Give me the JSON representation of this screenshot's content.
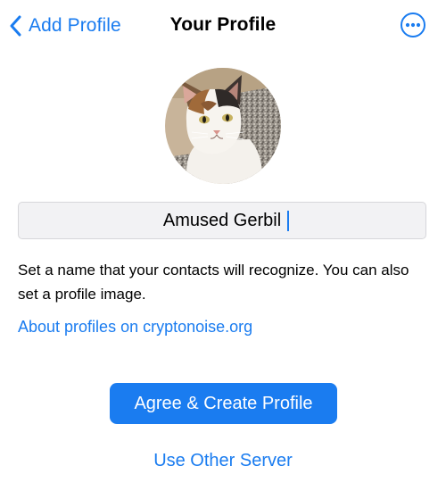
{
  "nav": {
    "back_label": "Add Profile",
    "title": "Your Profile",
    "more_icon": "ellipsis-circle-icon"
  },
  "profile": {
    "avatar_description": "profile photo",
    "name_value": "Amused Gerbil"
  },
  "help": {
    "text": "Set a name that your contacts will recognize. You can also set a profile image.",
    "link_label": "About profiles on cryptonoise.org"
  },
  "actions": {
    "primary_label": "Agree & Create Profile",
    "secondary_label": "Use Other Server"
  },
  "colors": {
    "accent": "#1a7cf0",
    "field_background": "#f2f2f4",
    "background": "#ffffff"
  }
}
